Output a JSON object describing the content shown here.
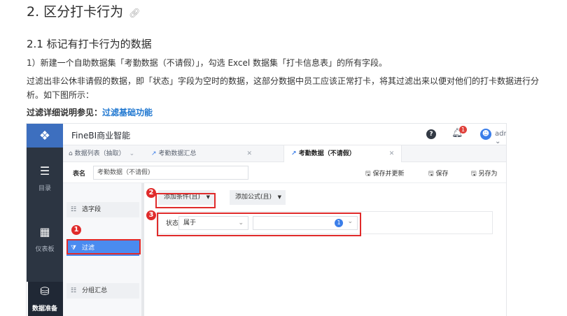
{
  "doc": {
    "h2": "2. 区分打卡行为",
    "h3": "2.1 标记有打卡行为的数据",
    "para1": "1）新建一个自助数据集「考勤数据（不请假）」，勾选 Excel 数据集「打卡信息表」的所有字段。",
    "para2": "过滤出非公休非请假的数据，即「状态」字段为空时的数据，这部分数据中员工应该正常打卡，将其过滤出来以便对他们的打卡数据进行分析。如下图所示：",
    "para3_prefix": "过滤详细说明参见：",
    "para3_link": "过滤基础功能"
  },
  "app": {
    "brand": "FineBI商业智能",
    "notif_count": "1",
    "user": "admin",
    "help": "?",
    "nav": [
      {
        "label": "目录"
      },
      {
        "label": "仪表板"
      },
      {
        "label": "数据准备"
      }
    ],
    "tabs": [
      {
        "label": "数据列表（抽取）"
      },
      {
        "label": "考勤数据汇总"
      },
      {
        "label": "考勤数据（不请假）"
      }
    ],
    "table_name_label": "表名",
    "table_name_value": "考勤数据（不请假)",
    "actions": {
      "save_update": "保存并更新",
      "save": "保存",
      "save_as": "另存为"
    },
    "steps": [
      {
        "label": "选字段"
      },
      {
        "label": "过滤"
      },
      {
        "label": "分组汇总"
      }
    ],
    "add_condition": "添加条件(且)",
    "add_formula": "添加公式(且)",
    "condition": {
      "field": "状态",
      "operator": "属于",
      "value_badge": "1"
    },
    "markers": [
      "1",
      "2",
      "3"
    ]
  }
}
